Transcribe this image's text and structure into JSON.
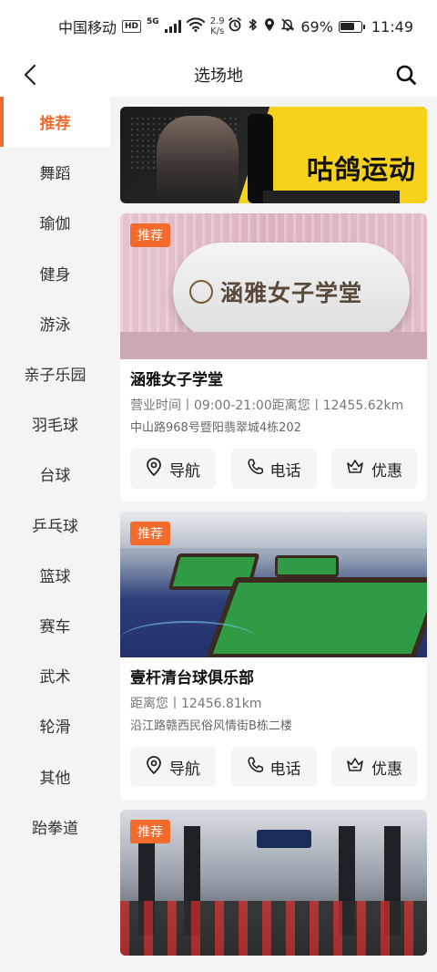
{
  "status_bar": {
    "carrier": "中国移动",
    "hd": "HD",
    "network": "5G",
    "speed_value": "2.9",
    "speed_unit": "K/s",
    "battery": "69%",
    "battery_level": 0.69,
    "time": "11:49"
  },
  "header": {
    "title": "选场地"
  },
  "sidebar": {
    "items": [
      {
        "label": "推荐"
      },
      {
        "label": "舞蹈"
      },
      {
        "label": "瑜伽"
      },
      {
        "label": "健身"
      },
      {
        "label": "游泳"
      },
      {
        "label": "亲子乐园"
      },
      {
        "label": "羽毛球"
      },
      {
        "label": "台球"
      },
      {
        "label": "乒乓球"
      },
      {
        "label": "篮球"
      },
      {
        "label": "赛车"
      },
      {
        "label": "武术"
      },
      {
        "label": "轮滑"
      },
      {
        "label": "其他"
      },
      {
        "label": "跆拳道"
      }
    ]
  },
  "banner": {
    "text": "咕鸽运动"
  },
  "venues": [
    {
      "badge": "推荐",
      "sign": "涵雅女子学堂",
      "name": "涵雅女子学堂",
      "info": "营业时间丨09:00-21:00距离您丨12455.62km",
      "address": "中山路968号暨阳翡翠城4栋202"
    },
    {
      "badge": "推荐",
      "name": "壹杆清台球俱乐部",
      "info": "距离您丨12456.81km",
      "address": "沿江路赣西民俗风情街B栋二楼"
    },
    {
      "badge": "推荐"
    }
  ],
  "actions": {
    "navigate": "导航",
    "phone": "电话",
    "discount": "优惠"
  },
  "colors": {
    "accent": "#f26a2c"
  }
}
